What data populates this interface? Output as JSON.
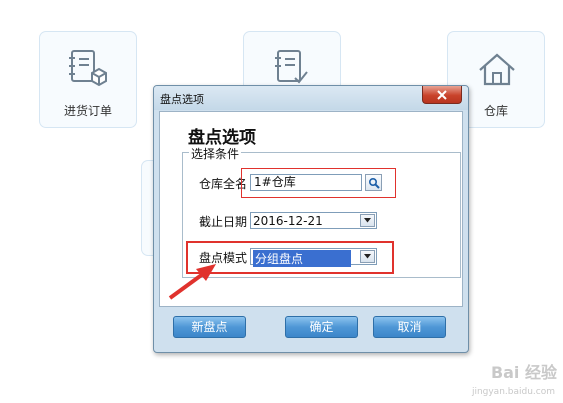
{
  "tiles": {
    "purchase_order": {
      "label": "进货订单"
    },
    "warehouse": {
      "label": "仓库"
    }
  },
  "dialog": {
    "window_title": "盘点选项",
    "heading": "盘点选项",
    "group_label": "选择条件",
    "fields": {
      "warehouse": {
        "label": "仓库全名",
        "value": "1#仓库"
      },
      "end_date": {
        "label": "截止日期",
        "value": "2016-12-21"
      },
      "mode": {
        "label": "盘点模式",
        "value": "分组盘点"
      }
    },
    "buttons": {
      "new_count": "新盘点",
      "ok": "确定",
      "cancel": "取消"
    }
  },
  "watermark": {
    "brand": "Bai 经验",
    "url": "jingyan.baidu.com"
  },
  "colors": {
    "annotation_red": "#e0322d",
    "button_blue": "#4f97d6",
    "dialog_frame": "#cfe0ee",
    "selection_blue": "#3a6fd0"
  }
}
